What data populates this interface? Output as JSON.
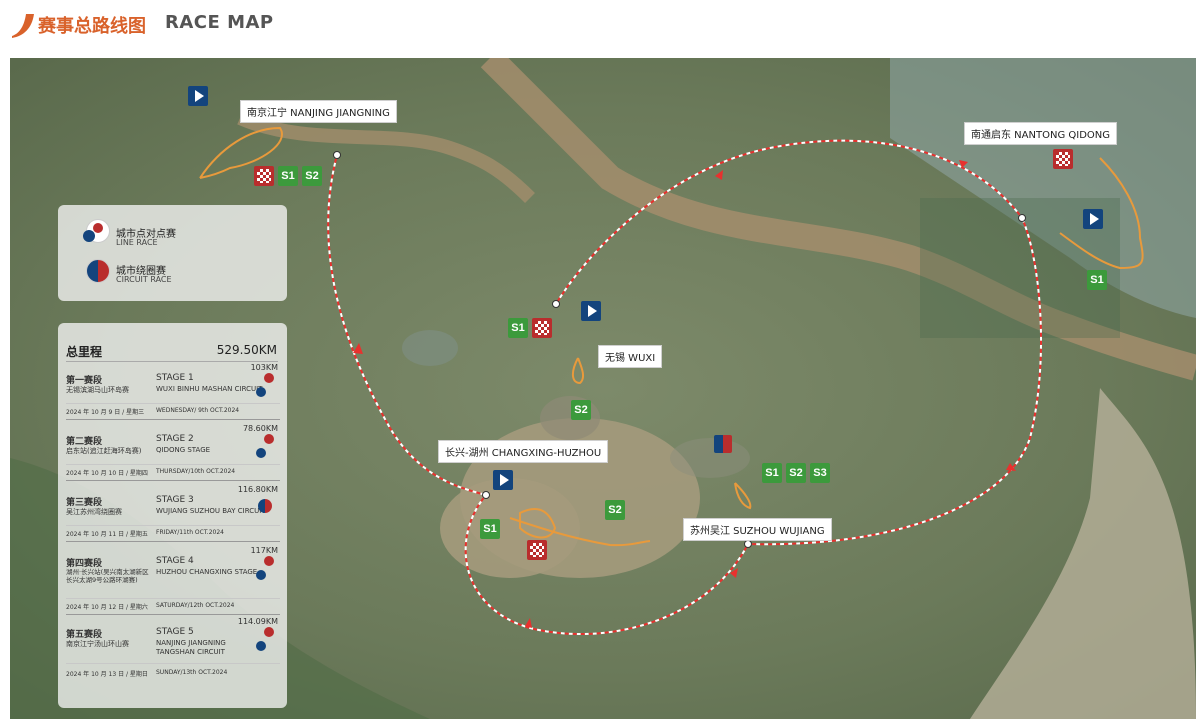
{
  "header": {
    "title_cn": "赛事总路线图",
    "title_en": "RACE MAP"
  },
  "cities": {
    "nanjing": "南京江宁  NANJING JIANGNING",
    "nantong": "南通启东  NANTONG QIDONG",
    "wuxi": "无锡  WUXI",
    "changxing": "长兴-湖州  CHANGXING-HUZHOU",
    "suzhou": "苏州吴江  SUZHOU WUJIANG"
  },
  "badges": {
    "s1": "S1",
    "s2": "S2",
    "s3": "S3"
  },
  "legend": {
    "line_cn": "城市点对点赛",
    "line_en": "LINE RACE",
    "circuit_cn": "城市绕圈赛",
    "circuit_en": "CIRCUIT RACE"
  },
  "summary": {
    "label": "总里程",
    "total": "529.50KM"
  },
  "stages": [
    {
      "cn": "第一赛段",
      "en": "STAGE   1",
      "desc_cn": "无锡滨湖马山环岛赛",
      "desc_en": "WUXI BINHU MASHAN CIRCUIT",
      "km": "103KM",
      "date_cn": "2024 年 10 月 9 日 / 星期三",
      "date_en": "WEDNESDAY/ 9th OCT.2024"
    },
    {
      "cn": "第二赛段",
      "en": "STAGE   2",
      "desc_cn": "启东站(追江赶海环岛赛)",
      "desc_en": "QIDONG STAGE",
      "km": "78.60KM",
      "date_cn": "2024 年 10 月 10 日 / 星期四",
      "date_en": "THURSDAY/10th OCT.2024"
    },
    {
      "cn": "第三赛段",
      "en": "STAGE   3",
      "desc_cn": "吴江苏州湾绕圈赛",
      "desc_en": "WUJIANG SUZHOU BAY CIRCUIT",
      "km": "116.80KM",
      "date_cn": "2024 年 10 月 11 日 / 星期五",
      "date_en": "FRIDAY/11th OCT.2024"
    },
    {
      "cn": "第四赛段",
      "en": "STAGE   4",
      "desc_cn": "湖州·长兴站(吴兴南太湖新区长兴太湖9号公路环湖赛)",
      "desc_en": "HUZHOU CHANGXING STAGE",
      "km": "117KM",
      "date_cn": "2024 年 10 月 12 日 / 星期六",
      "date_en": "SATURDAY/12th OCT.2024"
    },
    {
      "cn": "第五赛段",
      "en": "STAGE   5",
      "desc_cn": "南京江宁汤山环山赛",
      "desc_en": "NANJING JIANGNING TANGSHAN CIRCUIT",
      "km": "114.09KM",
      "date_cn": "2024 年 10 月 13 日 / 星期日",
      "date_en": "SUNDAY/13th OCT.2024"
    }
  ],
  "colors": {
    "accent": "#d9622b",
    "route": "#e8312e",
    "track": "#e89a3c",
    "start": "#13447d",
    "finish": "#b92d2d",
    "badge": "#3c9a3c"
  }
}
